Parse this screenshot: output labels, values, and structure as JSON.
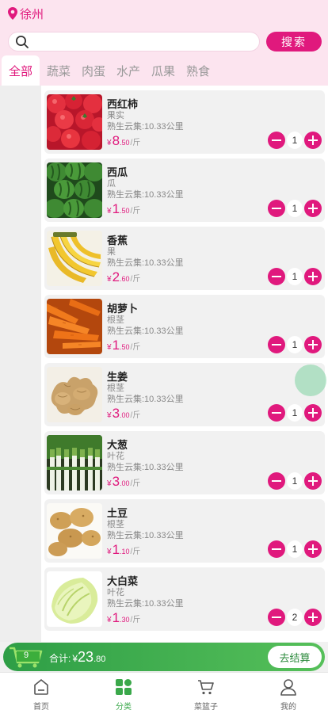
{
  "header": {
    "location": "徐州",
    "search": {
      "placeholder": "",
      "value": "",
      "button": "搜索"
    },
    "tabs": [
      {
        "label": "全部",
        "active": true
      },
      {
        "label": "蔬菜",
        "active": false
      },
      {
        "label": "肉蛋",
        "active": false
      },
      {
        "label": "水产",
        "active": false
      },
      {
        "label": "瓜果",
        "active": false
      },
      {
        "label": "熟食",
        "active": false
      }
    ]
  },
  "products": [
    {
      "name": "西红柿",
      "category": "果实",
      "distance": "熟生云集:10.33公里",
      "currency": "¥",
      "price_int": "8",
      "price_dec": ".50",
      "unit": "/斤",
      "qty": "1",
      "image": "tomato"
    },
    {
      "name": "西瓜",
      "category": "瓜",
      "distance": "熟生云集:10.33公里",
      "currency": "¥",
      "price_int": "1",
      "price_dec": ".50",
      "unit": "/斤",
      "qty": "1",
      "image": "watermelon"
    },
    {
      "name": "香蕉",
      "category": "果",
      "distance": "熟生云集:10.33公里",
      "currency": "¥",
      "price_int": "2",
      "price_dec": ".60",
      "unit": "/斤",
      "qty": "1",
      "image": "banana"
    },
    {
      "name": "胡萝卜",
      "category": "根茎",
      "distance": "熟生云集:10.33公里",
      "currency": "¥",
      "price_int": "1",
      "price_dec": ".50",
      "unit": "/斤",
      "qty": "1",
      "image": "carrot"
    },
    {
      "name": "生姜",
      "category": "根茎",
      "distance": "熟生云集:10.33公里",
      "currency": "¥",
      "price_int": "3",
      "price_dec": ".00",
      "unit": "/斤",
      "qty": "1",
      "image": "ginger"
    },
    {
      "name": "大葱",
      "category": "叶花",
      "distance": "熟生云集:10.33公里",
      "currency": "¥",
      "price_int": "3",
      "price_dec": ".00",
      "unit": "/斤",
      "qty": "1",
      "image": "scallion"
    },
    {
      "name": "土豆",
      "category": "根茎",
      "distance": "熟生云集:10.33公里",
      "currency": "¥",
      "price_int": "1",
      "price_dec": ".10",
      "unit": "/斤",
      "qty": "1",
      "image": "potato"
    },
    {
      "name": "大白菜",
      "category": "叶花",
      "distance": "熟生云集:10.33公里",
      "currency": "¥",
      "price_int": "1",
      "price_dec": ".30",
      "unit": "/斤",
      "qty": "2",
      "image": "cabbage"
    }
  ],
  "cart": {
    "count": "9",
    "total_label": "合计:",
    "currency": "¥",
    "total_int": "23",
    "total_dec": ".80",
    "checkout": "去结算"
  },
  "nav": [
    {
      "label": "首页",
      "icon": "home-icon",
      "active": false
    },
    {
      "label": "分类",
      "icon": "category-icon",
      "active": true
    },
    {
      "label": "菜篮子",
      "icon": "basket-icon",
      "active": false
    },
    {
      "label": "我的",
      "icon": "user-icon",
      "active": false
    }
  ],
  "colors": {
    "accent": "#e0197d",
    "header_bg": "#fce4ef",
    "cart_green": "#3aa84a"
  }
}
